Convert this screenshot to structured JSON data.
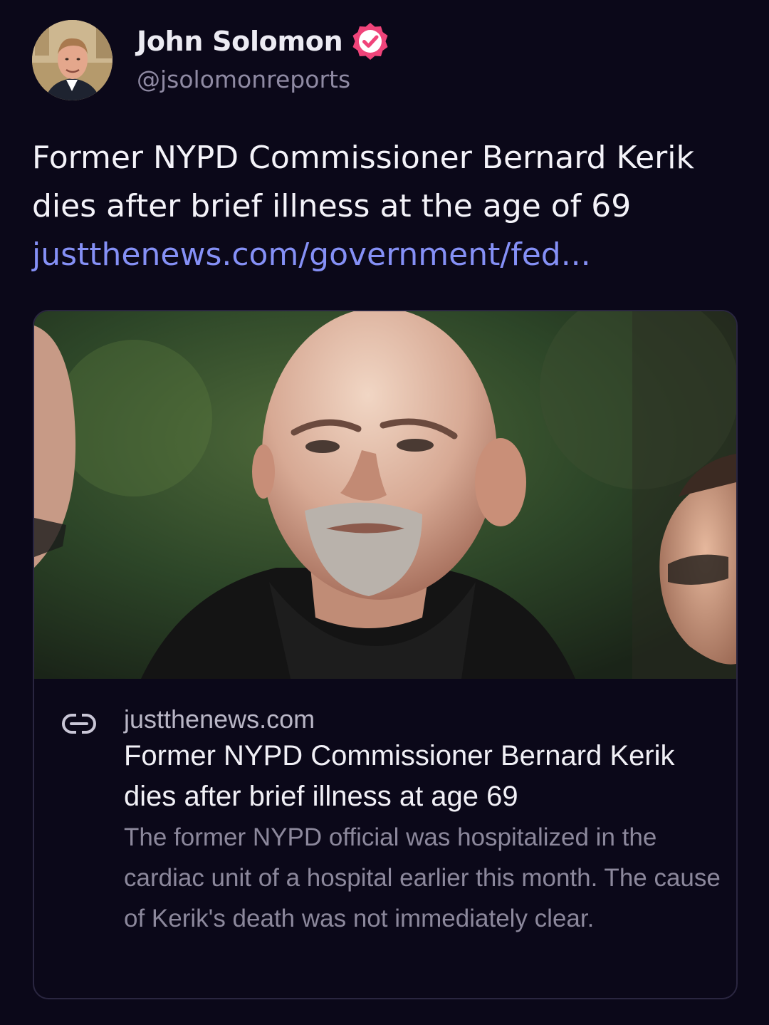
{
  "author": {
    "name": "John Solomon",
    "handle": "@jsolomonreports",
    "verified": true,
    "avatar_icon": "profile-photo"
  },
  "post": {
    "text": "Former NYPD Commissioner Bernard Kerik dies after brief illness at the age of 69",
    "link_text": "justthenews.com/government/fed..."
  },
  "link_card": {
    "icon": "link-icon",
    "domain": "justthenews.com",
    "title": "Former NYPD Commissioner Bernard Kerik dies after brief illness at age 69",
    "description": "The former NYPD official was hospitalized in the cardiac unit of a hospital earlier this month. The cause of Kerik's death was not immediately clear."
  },
  "colors": {
    "background": "#0b0819",
    "link": "#8590f6",
    "verified_badge": "#f0447a",
    "card_border": "#2a2640",
    "secondary_text": "#8c889c"
  }
}
